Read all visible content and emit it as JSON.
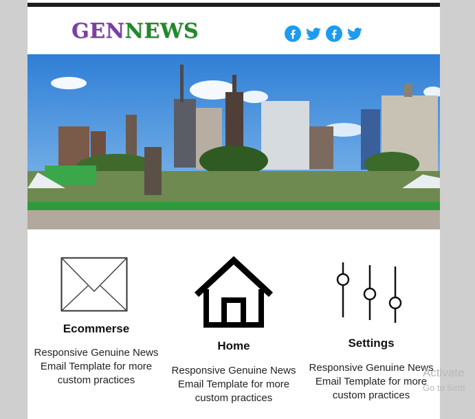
{
  "brand": {
    "logo_part1": "GEN",
    "logo_part2": "NEWS"
  },
  "social": [
    {
      "icon": "facebook-icon"
    },
    {
      "icon": "twitter-icon"
    },
    {
      "icon": "facebook-icon"
    },
    {
      "icon": "twitter-icon"
    }
  ],
  "hero": {
    "image": "city-skyline-image"
  },
  "features": [
    {
      "icon": "envelope-icon",
      "title": "Ecommerse",
      "desc_lines": [
        "Responsive Genuine News",
        "Email Template for more",
        "custom practices"
      ]
    },
    {
      "icon": "home-icon",
      "title": "Home",
      "desc_lines": [
        "Responsive Genuine News",
        "Email Template for more",
        "custom practices"
      ]
    },
    {
      "icon": "sliders-icon",
      "title": "Settings",
      "desc_lines": [
        "Responsive Genuine News",
        "Email Template for more",
        "custom practices"
      ]
    }
  ],
  "watermark": {
    "line1": "Activate",
    "line2": "Go to Setti"
  },
  "colors": {
    "logo_gen": "#7a3fa3",
    "logo_news": "#1f8a2a",
    "social": "#1d9bf0",
    "background": "#cfcfcf",
    "topbar": "#1e1e1e"
  }
}
